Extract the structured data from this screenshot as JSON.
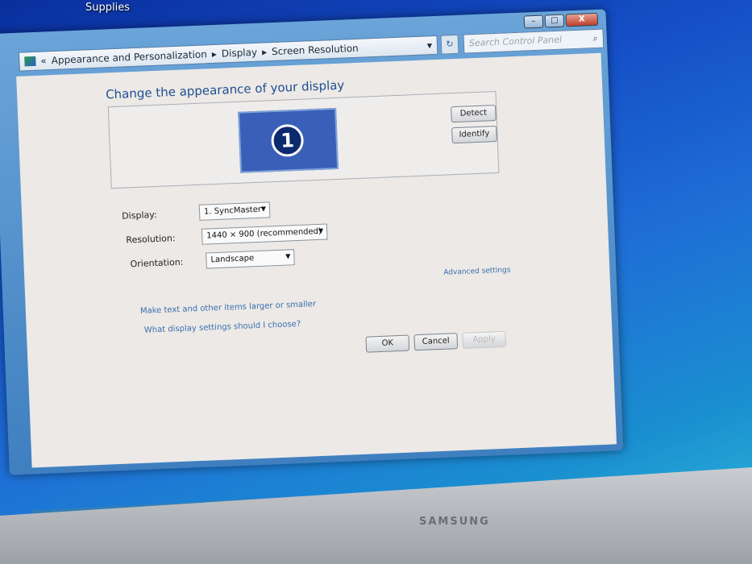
{
  "desktop": {
    "icon_label": "Supplies"
  },
  "window": {
    "breadcrumb": {
      "prefix": "«",
      "items": [
        "Appearance and Personalization",
        "Display",
        "Screen Resolution"
      ]
    },
    "search_placeholder": "Search Control Panel",
    "caption": {
      "minimize": "–",
      "maximize": "□",
      "close": "X"
    },
    "title": "Change the appearance of your display",
    "monitor_number": "1",
    "detect_label": "Detect",
    "identify_label": "Identify",
    "display": {
      "label": "Display:",
      "value": "1. SyncMaster"
    },
    "resolution": {
      "label": "Resolution:",
      "value": "1440 × 900 (recommended)"
    },
    "orientation": {
      "label": "Orientation:",
      "value": "Landscape"
    },
    "advanced_link": "Advanced settings",
    "links": [
      "Make text and other items larger or smaller",
      "What display settings should I choose?"
    ],
    "ok_label": "OK",
    "cancel_label": "Cancel",
    "apply_label": "Apply"
  },
  "monitor": {
    "brand": "SAMSUNG"
  }
}
